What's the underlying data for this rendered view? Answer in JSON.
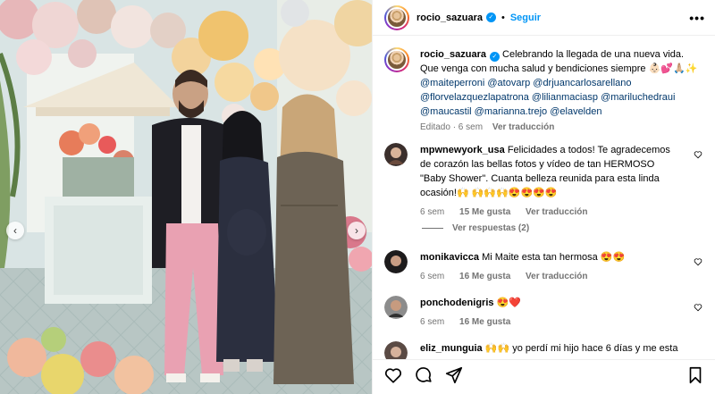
{
  "post": {
    "username": "rocio_sazuara",
    "follow_label": "Seguir",
    "more_label": "•••",
    "header_separator": "•"
  },
  "caption": {
    "username": "rocio_sazuara",
    "text": "Celebrando la llegada de una nueva vida. Que venga con mucha salud y bendiciones siempre 👶🏻💕🙏🏼✨",
    "mentions_line1": "@maiteperroni @atovarp @drjuancarlosarellano",
    "mentions_line2": "@florvelazquezlapatrona @lilianmaciasp @mariluchedraui",
    "mentions_line3": "@maucastil @marianna.trejo @elavelden",
    "edited": "Editado · 6 sem",
    "see_translation": "Ver traducción"
  },
  "comments": [
    {
      "username": "mpwnewyork_usa",
      "text": "Felicidades a todos! Te agradecemos de corazón las bellas fotos y vídeo de tan HERMOSO \"Baby Shower\". Cuanta belleza reunida para esta linda ocasión!🙌 🙌🙌🙌😍😍😍😍",
      "time": "6 sem",
      "likes": "15 Me gusta",
      "translate": "Ver traducción",
      "replies": "Ver respuestas (2)"
    },
    {
      "username": "monikavicca",
      "text": "Mi Maite esta tan hermosa 😍😍",
      "time": "6 sem",
      "likes": "16 Me gusta",
      "translate": "Ver traducción"
    },
    {
      "username": "ponchodenigris",
      "text": "😍❤️",
      "time": "6 sem",
      "likes": "16 Me gusta"
    },
    {
      "username": "eliz_munguia",
      "text": "🙌🙌 yo perdí mi hijo hace 6 días y me esta"
    }
  ],
  "icons": {
    "like": "heart-icon",
    "comment": "comment-icon",
    "share": "share-icon",
    "save": "bookmark-icon"
  },
  "colors": {
    "accent": "#0095f6",
    "mention": "#00376b",
    "muted": "#737373"
  }
}
